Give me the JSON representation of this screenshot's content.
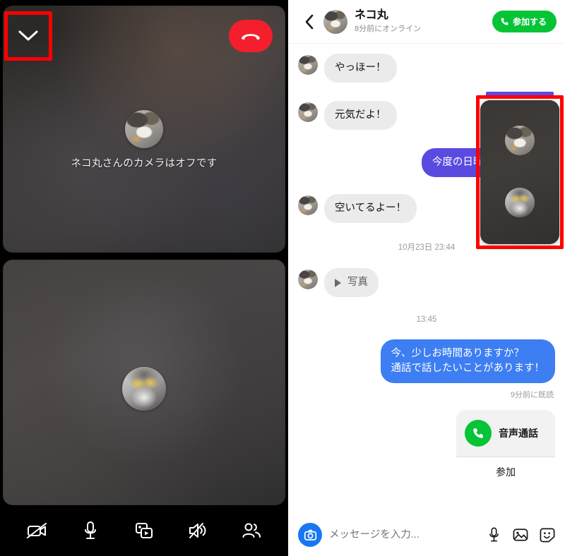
{
  "call": {
    "collapse_icon": "chevron-down-icon",
    "hangup_icon": "phone-hangup-icon",
    "camera_off_text": "ネコ丸さんのカメラはオフです",
    "toolbar": [
      {
        "name": "camera-off-icon",
        "label": "カメラ"
      },
      {
        "name": "microphone-icon",
        "label": "マイク"
      },
      {
        "name": "media-share-icon",
        "label": "メディア共有"
      },
      {
        "name": "speaker-muted-icon",
        "label": "スピーカー"
      },
      {
        "name": "participants-icon",
        "label": "参加者"
      }
    ]
  },
  "chat": {
    "header": {
      "back_icon": "chevron-left-icon",
      "avatar_icon": "cat-avatar",
      "name": "ネコ丸",
      "status": "8分前にオンライン",
      "join_label": "参加する",
      "join_icon": "phone-icon",
      "join_color": "#06c436"
    },
    "messages": [
      {
        "side": "in",
        "text": "やっほー！"
      },
      {
        "side": "in",
        "text": "元気だよ！"
      },
      {
        "side": "out",
        "text": "今度の日曜日空いてる？",
        "color": "#5b4ae0"
      },
      {
        "side": "in",
        "text": "空いてるよー！"
      },
      {
        "side": "timestamp",
        "text": "10月23日 23:44"
      },
      {
        "side": "in-photo",
        "text": "写真",
        "icon": "play-icon"
      },
      {
        "side": "timestamp",
        "text": "13:45"
      },
      {
        "side": "out",
        "text": "今、少しお時間ありますか？\n通話で話したいことがあります！",
        "color": "#3d7ef2"
      },
      {
        "side": "read-receipt",
        "text": "9分前に既読"
      }
    ],
    "call_card": {
      "icon": "phone-icon",
      "title": "音声通話",
      "join_label": "参加"
    },
    "pip": {
      "name": "picture-in-picture-video",
      "avatars": [
        "cat-avatar",
        "cat-avatar-gray"
      ]
    },
    "input": {
      "camera_icon": "camera-icon",
      "placeholder": "メッセージを入力...",
      "value": "",
      "icons": [
        {
          "name": "microphone-icon"
        },
        {
          "name": "image-icon"
        },
        {
          "name": "sticker-icon"
        }
      ]
    }
  }
}
